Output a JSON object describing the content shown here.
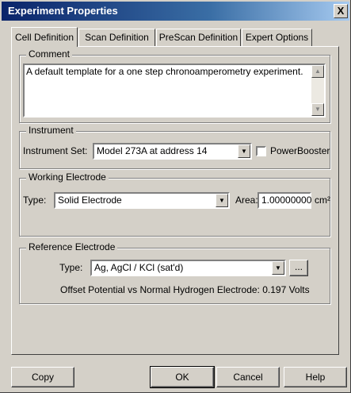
{
  "window": {
    "title": "Experiment Properties",
    "close_label": "X"
  },
  "tabs": [
    {
      "label": "Cell Definition",
      "active": true
    },
    {
      "label": "Scan Definition",
      "active": false
    },
    {
      "label": "PreScan Definition",
      "active": false
    },
    {
      "label": "Expert Options",
      "active": false
    }
  ],
  "comment": {
    "group_label": "Comment",
    "value": "A default template for a one step chronoamperometry experiment."
  },
  "instrument": {
    "group_label": "Instrument",
    "set_label": "Instrument Set:",
    "set_value": "Model 273A at address 14",
    "powerbooster_label": "PowerBooster",
    "powerbooster_checked": false
  },
  "working_electrode": {
    "group_label": "Working Electrode",
    "type_label": "Type:",
    "type_value": "Solid Electrode",
    "area_label": "Area:",
    "area_value": "1.00000000",
    "area_unit": "cm²"
  },
  "reference_electrode": {
    "group_label": "Reference Electrode",
    "type_label": "Type:",
    "type_value": "Ag, AgCl / KCl (sat'd)",
    "browse_label": "...",
    "offset_text": "Offset Potential vs Normal Hydrogen Electrode:  0.197 Volts"
  },
  "buttons": {
    "copy": "Copy",
    "ok": "OK",
    "cancel": "Cancel",
    "help": "Help"
  },
  "icons": {
    "dropdown": "▼",
    "scroll_up": "▲",
    "scroll_down": "▼"
  }
}
